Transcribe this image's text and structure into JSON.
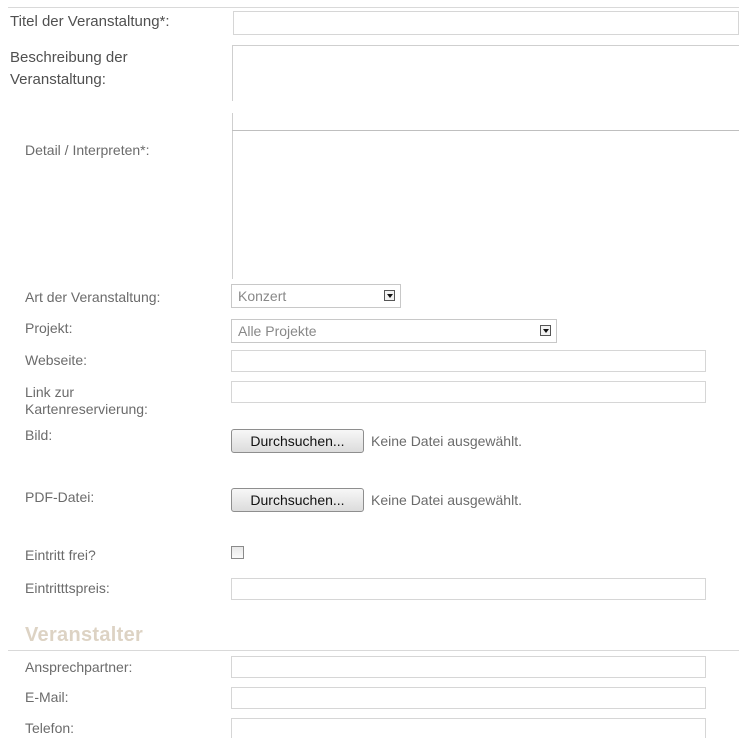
{
  "form": {
    "title_label": "Titel der Veranstaltung*:",
    "description_label_line1": "Beschreibung der",
    "description_label_line2": "Veranstaltung:",
    "detail_label": "Detail / Interpreten*:",
    "type_label": "Art der Veranstaltung:",
    "type_value": "Konzert",
    "project_label": "Projekt:",
    "project_value": "Alle Projekte",
    "website_label": "Webseite:",
    "ticket_link_label_line1": "Link zur",
    "ticket_link_label_line2": "Kartenreservierung:",
    "image_label": "Bild:",
    "pdf_label": "PDF-Datei:",
    "browse_button": "Durchsuchen...",
    "no_file_text": "Keine Datei ausgewählt.",
    "free_entry_label": "Eintritt frei?",
    "free_entry_checked": false,
    "price_label": "Eintritttspreis:"
  },
  "organizer": {
    "heading": "Veranstalter",
    "contact_label": "Ansprechpartner:",
    "email_label": "E-Mail:",
    "phone_label": "Telefon:"
  }
}
